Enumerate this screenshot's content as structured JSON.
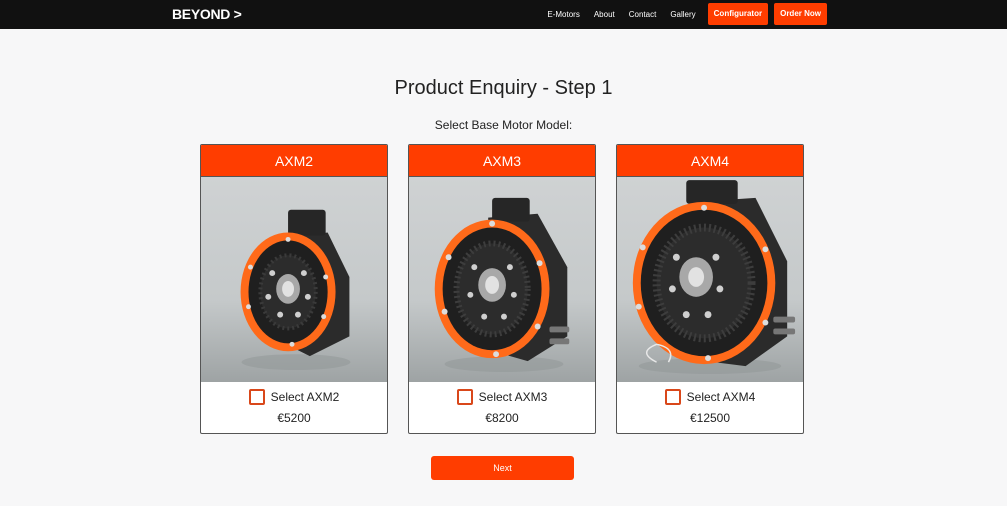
{
  "nav": {
    "logo": "BEYOND >",
    "links": [
      "E-Motors",
      "About",
      "Contact",
      "Gallery"
    ],
    "configurator_label": "Configurator",
    "order_label": "Order Now"
  },
  "page": {
    "title": "Product Enquiry - Step 1",
    "subtitle": "Select Base Motor Model:"
  },
  "models": [
    {
      "name": "AXM2",
      "select_label": "Select AXM2",
      "price": "€5200",
      "image_icon": "motor-photo"
    },
    {
      "name": "AXM3",
      "select_label": "Select AXM3",
      "price": "€8200",
      "image_icon": "motor-photo"
    },
    {
      "name": "AXM4",
      "select_label": "Select AXM4",
      "price": "€12500",
      "image_icon": "motor-photo"
    }
  ],
  "next_label": "Next",
  "colors": {
    "accent": "#ff3d00",
    "navbar": "#111111",
    "background": "#f7f7f8",
    "checkbox_border": "#d9471a"
  }
}
